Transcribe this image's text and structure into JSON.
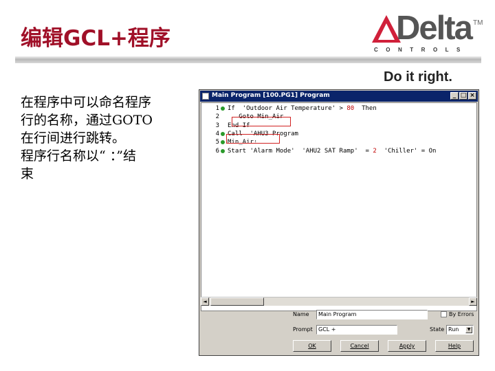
{
  "slide": {
    "title": "编辑GCL+程序",
    "body_lines": [
      "在程序中可以命名程序",
      "行的名称，通过GOTO",
      "在行间进行跳转。",
      "程序行名称以“ ：”结",
      "束"
    ]
  },
  "logo": {
    "word": "Delta",
    "tm": "TM",
    "sub": "CONTROLS",
    "tagline": "Do it right.",
    "triangle_color": "#d0203a"
  },
  "window": {
    "title": "Main Program   [100.PG1]   Program",
    "buttons": {
      "minimize": "_",
      "maximize": "□",
      "close": "×"
    },
    "code_lines": [
      {
        "num": "1",
        "text": "If  'Outdoor Air Temperature' > ",
        "value": "80",
        "tail": "  Then",
        "breakpoint": true
      },
      {
        "num": "2",
        "text": "   Goto Min_Air",
        "value": "",
        "tail": "",
        "breakpoint": false
      },
      {
        "num": "3",
        "text": "End If",
        "value": "",
        "tail": "",
        "breakpoint": false
      },
      {
        "num": "4",
        "text": "Call  'AHU3 Program",
        "value": "",
        "tail": "",
        "breakpoint": true
      },
      {
        "num": "5",
        "text": "Min_Air:",
        "value": "",
        "tail": "",
        "breakpoint": true
      },
      {
        "num": "6",
        "text": "Start 'Alarm Mode'  'AHU2 SAT Ramp'  = ",
        "value": "2",
        "tail": "  'Chiller' = On",
        "breakpoint": true
      }
    ],
    "scroll": {
      "left": "◄",
      "right": "►"
    },
    "form": {
      "name_label": "Name",
      "name_value": "Main Program",
      "prompt_label": "Prompt",
      "prompt_value": "GCL +",
      "errors_label": "By Errors",
      "state_label": "State",
      "state_value": "Run",
      "state_arrow": "▼"
    },
    "actions": {
      "ok": "OK",
      "cancel": "Cancel",
      "apply": "Apply",
      "help": "Help"
    }
  }
}
